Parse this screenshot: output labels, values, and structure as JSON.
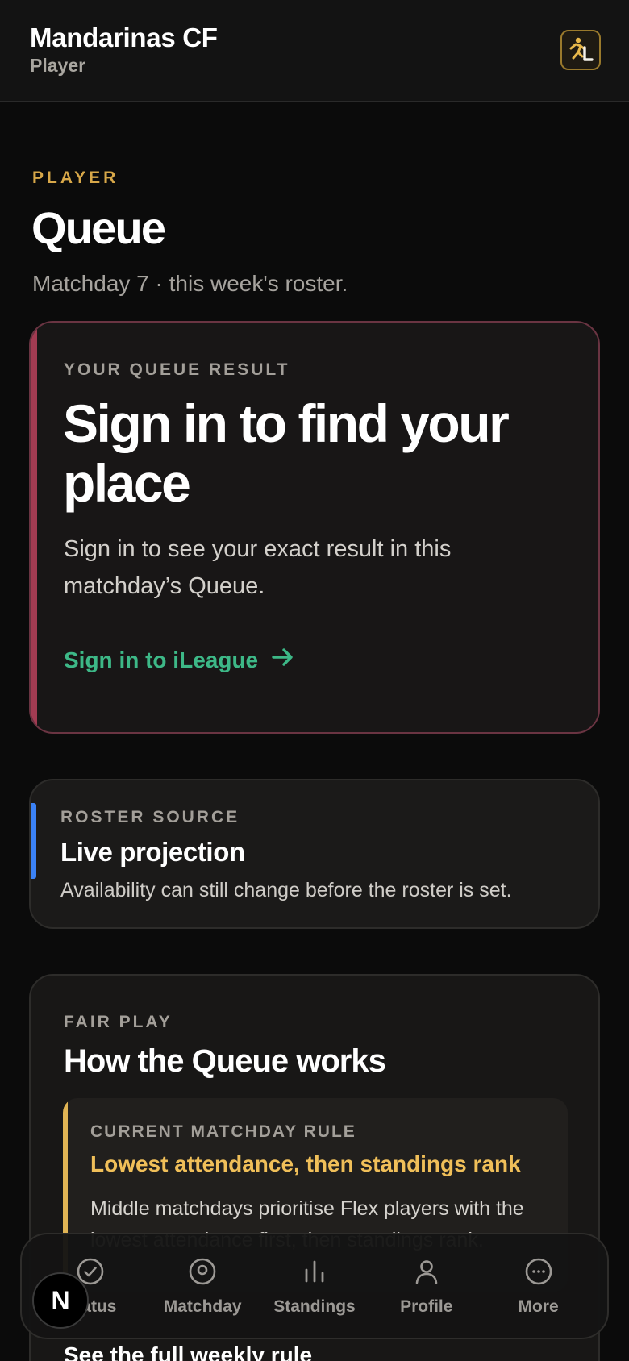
{
  "header": {
    "title": "Mandarinas CF",
    "subtitle": "Player",
    "logo_icon": "ileague-runner-logo"
  },
  "page": {
    "eyebrow": "PLAYER",
    "title": "Queue",
    "subtitle": "Matchday 7 · this week's roster."
  },
  "result_card": {
    "label": "YOUR QUEUE RESULT",
    "heading": "Sign in to find your place",
    "body": "Sign in to see your exact result in this matchday’s Queue.",
    "link_label": "Sign in to iLeague",
    "link_icon": "arrow-right-icon",
    "accent_color": "#a23b52"
  },
  "roster_card": {
    "label": "ROSTER SOURCE",
    "title": "Live projection",
    "body": "Availability can still change before the roster is set.",
    "accent_color": "#3b82f6"
  },
  "fair_play_card": {
    "label": "FAIR PLAY",
    "title": "How the Queue works",
    "rule": {
      "label": "CURRENT MATCHDAY RULE",
      "title": "Lowest attendance, then standings rank",
      "body": "Middle matchdays prioritise Flex players with the lowest attendance first, then standings rank.",
      "accent_color": "#e0b454"
    },
    "full_rule_link": "See the full weekly rule"
  },
  "bottom_nav": {
    "items": [
      {
        "label": "Status",
        "icon": "check-circle-icon"
      },
      {
        "label": "Matchday",
        "icon": "target-icon"
      },
      {
        "label": "Standings",
        "icon": "bar-chart-icon"
      },
      {
        "label": "Profile",
        "icon": "user-icon"
      },
      {
        "label": "More",
        "icon": "more-circle-icon"
      }
    ]
  },
  "dev_badge": {
    "letter": "N"
  }
}
